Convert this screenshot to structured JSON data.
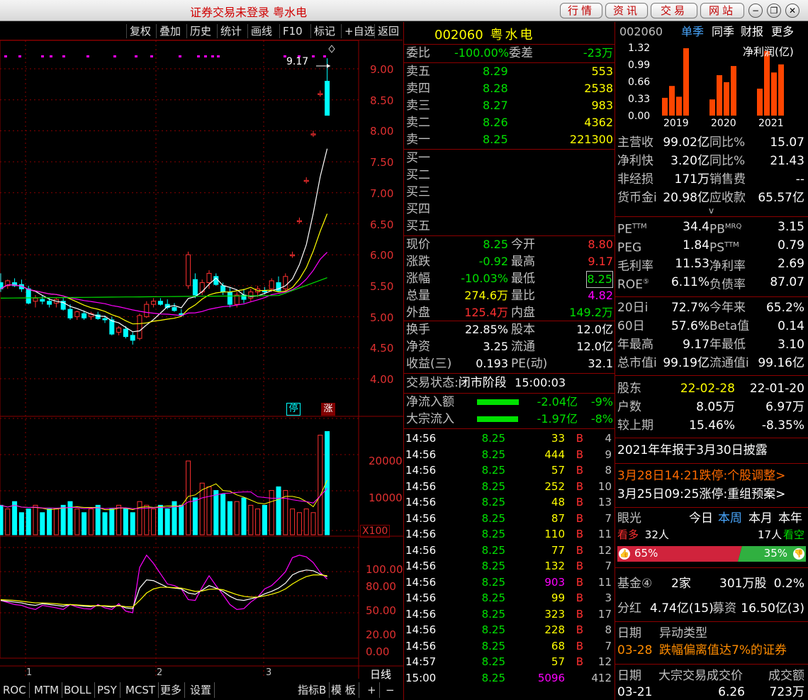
{
  "window": {
    "title": "证券交易未登录 粤水电",
    "nav": [
      "行情",
      "资讯",
      "交易",
      "网站"
    ],
    "controls": [
      "minimize",
      "restore",
      "close"
    ]
  },
  "toolbar": [
    "复权",
    "叠加",
    "历史",
    "统计",
    "画线",
    "F10",
    "标记",
    "+自选",
    "返回"
  ],
  "chart": {
    "price_ticks": [
      "9.00",
      "8.50",
      "8.00",
      "7.50",
      "7.00",
      "6.50",
      "6.00",
      "5.50",
      "5.00",
      "4.50",
      "4.00"
    ],
    "high_marker": "9.17",
    "badges": [
      "停",
      "涨"
    ],
    "vol_ticks": [
      "20000",
      "10000"
    ],
    "vol_unit": "X100",
    "ind_ticks": [
      "100.00",
      "80.00",
      "50.00",
      "20.00",
      "0.00"
    ],
    "months": [
      "1",
      "2",
      "3"
    ],
    "period": "日线",
    "tabs": [
      "ROC",
      "MTM",
      "BOLL",
      "PSY",
      "MCST",
      "更多",
      "设置"
    ],
    "right_tabs": [
      "指标B",
      "模 板",
      "+",
      "−"
    ]
  },
  "chart_data": {
    "type": "candlestick",
    "title": "",
    "ylim": [
      4.0,
      9.3
    ],
    "candles": [
      {
        "o": 5.55,
        "h": 5.7,
        "l": 5.4,
        "c": 5.45
      },
      {
        "o": 5.5,
        "h": 5.6,
        "l": 5.45,
        "c": 5.58
      },
      {
        "o": 5.55,
        "h": 5.62,
        "l": 5.48,
        "c": 5.5
      },
      {
        "o": 5.52,
        "h": 5.6,
        "l": 5.4,
        "c": 5.45
      },
      {
        "o": 5.45,
        "h": 5.5,
        "l": 5.2,
        "c": 5.22
      },
      {
        "o": 5.25,
        "h": 5.35,
        "l": 5.15,
        "c": 5.3
      },
      {
        "o": 5.28,
        "h": 5.35,
        "l": 5.2,
        "c": 5.25
      },
      {
        "o": 5.25,
        "h": 5.3,
        "l": 5.15,
        "c": 5.2
      },
      {
        "o": 5.22,
        "h": 5.3,
        "l": 5.15,
        "c": 5.28
      },
      {
        "o": 5.25,
        "h": 5.3,
        "l": 5.1,
        "c": 5.12
      },
      {
        "o": 5.12,
        "h": 5.2,
        "l": 4.95,
        "c": 4.98
      },
      {
        "o": 5.0,
        "h": 5.1,
        "l": 4.95,
        "c": 5.08
      },
      {
        "o": 5.05,
        "h": 5.1,
        "l": 4.95,
        "c": 4.98
      },
      {
        "o": 5.0,
        "h": 5.08,
        "l": 4.95,
        "c": 5.05
      },
      {
        "o": 5.03,
        "h": 5.08,
        "l": 4.95,
        "c": 4.97
      },
      {
        "o": 4.97,
        "h": 5.02,
        "l": 4.9,
        "c": 4.95
      },
      {
        "o": 4.95,
        "h": 5.0,
        "l": 4.7,
        "c": 4.72
      },
      {
        "o": 4.75,
        "h": 4.85,
        "l": 4.7,
        "c": 4.82
      },
      {
        "o": 4.8,
        "h": 4.85,
        "l": 4.65,
        "c": 4.68
      },
      {
        "o": 4.7,
        "h": 4.75,
        "l": 4.55,
        "c": 4.62
      },
      {
        "o": 4.65,
        "h": 5.05,
        "l": 4.62,
        "c": 5.02
      },
      {
        "o": 5.0,
        "h": 5.25,
        "l": 4.98,
        "c": 5.2
      },
      {
        "o": 5.2,
        "h": 5.3,
        "l": 5.15,
        "c": 5.25
      },
      {
        "o": 5.25,
        "h": 5.3,
        "l": 5.18,
        "c": 5.2
      },
      {
        "o": 5.2,
        "h": 5.28,
        "l": 5.12,
        "c": 5.15
      },
      {
        "o": 5.15,
        "h": 5.22,
        "l": 5.08,
        "c": 5.1
      },
      {
        "o": 5.05,
        "h": 5.12,
        "l": 5.0,
        "c": 5.02
      },
      {
        "o": 5.5,
        "h": 6.05,
        "l": 5.45,
        "c": 6.0
      },
      {
        "o": 5.6,
        "h": 5.7,
        "l": 5.3,
        "c": 5.35
      },
      {
        "o": 5.4,
        "h": 5.6,
        "l": 5.35,
        "c": 5.55
      },
      {
        "o": 5.55,
        "h": 5.75,
        "l": 5.45,
        "c": 5.7
      },
      {
        "o": 5.65,
        "h": 5.7,
        "l": 5.5,
        "c": 5.52
      },
      {
        "o": 5.5,
        "h": 5.55,
        "l": 5.35,
        "c": 5.4
      },
      {
        "o": 5.4,
        "h": 5.48,
        "l": 5.15,
        "c": 5.2
      },
      {
        "o": 5.2,
        "h": 5.4,
        "l": 5.15,
        "c": 5.35
      },
      {
        "o": 5.35,
        "h": 5.45,
        "l": 5.22,
        "c": 5.28
      },
      {
        "o": 5.3,
        "h": 5.45,
        "l": 5.25,
        "c": 5.4
      },
      {
        "o": 5.4,
        "h": 5.5,
        "l": 5.32,
        "c": 5.45
      },
      {
        "o": 5.42,
        "h": 5.48,
        "l": 5.36,
        "c": 5.4
      },
      {
        "o": 5.45,
        "h": 5.62,
        "l": 5.4,
        "c": 5.58
      },
      {
        "o": 5.55,
        "h": 5.65,
        "l": 5.4,
        "c": 5.42
      },
      {
        "o": 5.45,
        "h": 5.7,
        "l": 5.42,
        "c": 5.65
      },
      {
        "o": 6.0,
        "h": 6.05,
        "l": 5.95,
        "c": 6.0
      },
      {
        "o": 6.55,
        "h": 6.6,
        "l": 6.5,
        "c": 6.55
      },
      {
        "o": 7.2,
        "h": 7.25,
        "l": 7.15,
        "c": 7.2
      },
      {
        "o": 7.95,
        "h": 8.0,
        "l": 7.9,
        "c": 7.95
      },
      {
        "o": 8.6,
        "h": 8.65,
        "l": 8.55,
        "c": 8.6
      },
      {
        "o": 8.8,
        "h": 9.17,
        "l": 8.25,
        "c": 8.25
      }
    ],
    "volume": [
      8,
      7,
      9,
      6,
      7,
      8,
      6,
      7,
      7,
      8,
      9,
      7,
      6,
      7,
      8,
      6,
      7,
      8,
      7,
      6,
      9,
      8,
      7,
      8,
      7,
      9,
      8,
      20,
      10,
      14,
      13,
      12,
      11,
      9,
      9,
      10,
      8,
      7,
      8,
      12,
      13,
      12,
      7,
      6,
      7,
      6,
      27,
      28
    ],
    "volume_unit": "X100"
  },
  "quote": {
    "code": "002060",
    "name": "粤水电",
    "weibi": {
      "label": "委比",
      "value": "-100.00%"
    },
    "weicha": {
      "label": "委差",
      "value": "-23万"
    },
    "asks": [
      {
        "label": "卖五",
        "price": "8.29",
        "vol": "553"
      },
      {
        "label": "卖四",
        "price": "8.28",
        "vol": "2538"
      },
      {
        "label": "卖三",
        "price": "8.27",
        "vol": "983"
      },
      {
        "label": "卖二",
        "price": "8.26",
        "vol": "4362"
      },
      {
        "label": "卖一",
        "price": "8.25",
        "vol": "221300"
      }
    ],
    "bids": [
      "买一",
      "买二",
      "买三",
      "买四",
      "买五"
    ],
    "stats": [
      {
        "l1": "现价",
        "v1": "8.25",
        "c1": "green",
        "l2": "今开",
        "v2": "8.80",
        "c2": "red"
      },
      {
        "l1": "涨跌",
        "v1": "-0.92",
        "c1": "green",
        "l2": "最高",
        "v2": "9.17",
        "c2": "red"
      },
      {
        "l1": "涨幅",
        "v1": "-10.03%",
        "c1": "green",
        "l2": "最低",
        "v2": "8.25",
        "c2": "green"
      },
      {
        "l1": "总量",
        "v1": "274.6万",
        "c1": "yellow",
        "l2": "量比",
        "v2": "4.82",
        "c2": "mag"
      },
      {
        "l1": "外盘",
        "v1": "125.4万",
        "c1": "red",
        "l2": "内盘",
        "v2": "149.2万",
        "c2": "green"
      }
    ],
    "stats2": [
      {
        "l1": "换手",
        "v1": "22.85%",
        "l2": "股本",
        "v2": "12.0亿"
      },
      {
        "l1": "净资",
        "v1": "3.25",
        "l2": "流通",
        "v2": "12.0亿"
      },
      {
        "l1": "收益(三)",
        "v1": "0.193",
        "l2": "PE(动)",
        "v2": "32.1"
      }
    ],
    "status_label": "交易状态:",
    "status_value": "闭市阶段",
    "status_time": "15:00:03",
    "flows": [
      {
        "label": "净流入额",
        "value": "-2.04亿",
        "pct": "-9%",
        "bar": 0.8
      },
      {
        "label": "大宗流入",
        "value": "-1.97亿",
        "pct": "-8%",
        "bar": 0.78
      }
    ],
    "ticks": [
      [
        "14:56",
        "8.25",
        "33",
        "B",
        "4"
      ],
      [
        "14:56",
        "8.25",
        "444",
        "B",
        "9"
      ],
      [
        "14:56",
        "8.25",
        "57",
        "B",
        "8"
      ],
      [
        "14:56",
        "8.25",
        "252",
        "B",
        "10"
      ],
      [
        "14:56",
        "8.25",
        "48",
        "B",
        "13"
      ],
      [
        "14:56",
        "8.25",
        "87",
        "B",
        "7"
      ],
      [
        "14:56",
        "8.25",
        "110",
        "B",
        "11"
      ],
      [
        "14:56",
        "8.25",
        "77",
        "B",
        "12"
      ],
      [
        "14:56",
        "8.25",
        "132",
        "B",
        "7"
      ],
      [
        "14:56",
        "8.25",
        "903",
        "B",
        "11"
      ],
      [
        "14:56",
        "8.25",
        "99",
        "B",
        "3"
      ],
      [
        "14:56",
        "8.25",
        "323",
        "B",
        "17"
      ],
      [
        "14:56",
        "8.25",
        "228",
        "B",
        "8"
      ],
      [
        "14:56",
        "8.25",
        "68",
        "B",
        "7"
      ],
      [
        "14:57",
        "8.25",
        "57",
        "B",
        "12"
      ],
      [
        "15:00",
        "8.25",
        "5096",
        "",
        "412"
      ]
    ]
  },
  "finance": {
    "code": "002060",
    "tabs": [
      "单季",
      "同季",
      "财报",
      "更多"
    ],
    "chart_title": "净利润(亿)",
    "y_ticks": [
      "1.32",
      "0.99",
      "0.66",
      "0.33",
      "0.00"
    ],
    "years": [
      "2019",
      "2020",
      "2021"
    ],
    "bars": [
      0.33,
      0.55,
      0.35,
      1.25,
      0.3,
      0.75,
      0.62,
      0.92,
      0.5,
      1.2,
      0.8,
      0.95
    ],
    "rows": [
      {
        "l1": "主营收",
        "v1": "99.02亿",
        "l2": "同比%",
        "v2": "15.07"
      },
      {
        "l1": "净利快",
        "v1": "3.20亿",
        "l2": "同比%",
        "v2": "21.43"
      },
      {
        "l1": "非经损",
        "v1": "171万",
        "l2": "销售费",
        "v2": "--"
      },
      {
        "l1": "货币金i",
        "v1": "20.98亿",
        "l2": "应收款",
        "v2": "65.57亿"
      }
    ],
    "ratios": [
      {
        "l1": "PE",
        "s1": "TTM",
        "v1": "34.4",
        "l2": "PB",
        "s2": "MRQ",
        "v2": "3.15"
      },
      {
        "l1": "PEG",
        "s1": "",
        "v1": "1.84",
        "l2": "PS",
        "s2": "TTM",
        "v2": "0.79"
      },
      {
        "l1": "毛利率",
        "s1": "",
        "v1": "11.53",
        "l2": "净利率",
        "s2": "",
        "v2": "2.69"
      },
      {
        "l1": "ROE",
        "s1": "⑤",
        "v1": "6.11%",
        "l2": "负债率",
        "s2": "",
        "v2": "87.07"
      }
    ],
    "perf": [
      {
        "l1": "20日i",
        "v1": "72.7%",
        "l2": "今年来",
        "v2": "65.2%"
      },
      {
        "l1": "60日",
        "v1": "57.6%",
        "l2": "Beta值",
        "v2": "0.14"
      },
      {
        "l1": "年最高",
        "v1": "9.17",
        "l2": "年最低",
        "v2": "3.10"
      },
      {
        "l1": "总市值i",
        "v1": "99.19亿",
        "l2": "流通值i",
        "v2": "99.16亿"
      }
    ],
    "holders": {
      "label": "股东",
      "d1": "22-02-28",
      "d2": "22-01-20",
      "rows": [
        {
          "l": "户数",
          "a": "8.05万",
          "b": "6.97万"
        },
        {
          "l": "较上期",
          "a": "15.46%",
          "b": "-8.35%"
        }
      ]
    },
    "notice": "2021年年报于3月30日披露",
    "news": [
      "3月28日14:21跌停:个股调整>",
      "3月25日09:25涨停:重组预案>"
    ],
    "eye": {
      "label": "眼光",
      "tabs": [
        "今日",
        "本周",
        "本月",
        "本年"
      ],
      "more": "看多",
      "more_n": "32人",
      "less_n": "17人",
      "less": "看空",
      "pct_more": "65%",
      "pct_less": "35%",
      "ratio": 0.65
    },
    "fund": {
      "label": "基金④",
      "a": "2家",
      "b": "301万股",
      "c": "0.2%"
    },
    "div": {
      "label": "分红",
      "a": "4.74亿(15)",
      "l2": "募资",
      "b": "16.50亿(3)"
    },
    "abn": {
      "h1": "日期",
      "h2": "异动类型",
      "date": "03-28",
      "type": "跌幅偏离值达7%的证券"
    },
    "block": {
      "h1": "日期",
      "h2": "大宗交易成交价",
      "h3": "成交额",
      "date": "03-21",
      "price": "6.26",
      "amt": "723万"
    }
  }
}
